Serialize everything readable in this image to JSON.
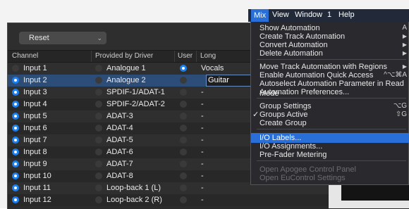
{
  "menubar": {
    "items": [
      "Mix",
      "View",
      "Window",
      "1",
      "Help"
    ]
  },
  "toolbar": {
    "reset_label": "Reset"
  },
  "table": {
    "headers": {
      "channel": "Channel",
      "driver": "Provided by Driver",
      "user": "User",
      "long": "Long"
    },
    "rows": [
      {
        "channel": "Input 1",
        "driver": "Analogue 1",
        "user_on": true,
        "long": "Vocals"
      },
      {
        "channel": "Input 2",
        "driver": "Analogue 2",
        "user_on": false,
        "long": "Guitar"
      },
      {
        "channel": "Input 3",
        "driver": "SPDIF-1/ADAT-1",
        "user_on": false,
        "long": "-"
      },
      {
        "channel": "Input 4",
        "driver": "SPDIF-2/ADAT-2",
        "user_on": false,
        "long": "-"
      },
      {
        "channel": "Input 5",
        "driver": "ADAT-3",
        "user_on": false,
        "long": "-"
      },
      {
        "channel": "Input 6",
        "driver": "ADAT-4",
        "user_on": false,
        "long": "-"
      },
      {
        "channel": "Input 7",
        "driver": "ADAT-5",
        "user_on": false,
        "long": "-"
      },
      {
        "channel": "Input 8",
        "driver": "ADAT-6",
        "user_on": false,
        "long": "-"
      },
      {
        "channel": "Input 9",
        "driver": "ADAT-7",
        "user_on": false,
        "long": "-"
      },
      {
        "channel": "Input 10",
        "driver": "ADAT-8",
        "user_on": false,
        "long": "-"
      },
      {
        "channel": "Input 11",
        "driver": "Loop-back 1 (L)",
        "user_on": false,
        "long": "-"
      },
      {
        "channel": "Input 12",
        "driver": "Loop-back 2 (R)",
        "user_on": false,
        "long": "-"
      }
    ]
  },
  "menu": {
    "items": [
      {
        "label": "Show Automation",
        "shortcut": "A",
        "submenu": false
      },
      {
        "label": "Create Track Automation",
        "shortcut": "",
        "submenu": true
      },
      {
        "label": "Convert Automation",
        "shortcut": "",
        "submenu": true
      },
      {
        "label": "Delete Automation",
        "shortcut": "",
        "submenu": true
      },
      {
        "label": "Move Track Automation with Regions",
        "shortcut": "",
        "submenu": true
      },
      {
        "label": "Enable Automation Quick Access",
        "shortcut": "^⌥⌘A",
        "submenu": false
      },
      {
        "label": "Autoselect Automation Parameter in Read Mode",
        "shortcut": "",
        "submenu": false
      },
      {
        "label": "Automation Preferences...",
        "shortcut": "",
        "submenu": false
      },
      {
        "label": "Group Settings",
        "shortcut": "⌥G",
        "submenu": false
      },
      {
        "label": "Groups Active",
        "shortcut": "⇧G",
        "submenu": false
      },
      {
        "label": "Create Group",
        "shortcut": "",
        "submenu": false
      },
      {
        "label": "I/O Labels...",
        "shortcut": "",
        "submenu": false
      },
      {
        "label": "I/O Assignments...",
        "shortcut": "",
        "submenu": false
      },
      {
        "label": "Pre-Fader Metering",
        "shortcut": "",
        "submenu": false
      },
      {
        "label": "Open Apogee Control Panel",
        "shortcut": "",
        "submenu": false
      },
      {
        "label": "Open EuControl Settings",
        "shortcut": "",
        "submenu": false
      }
    ]
  }
}
